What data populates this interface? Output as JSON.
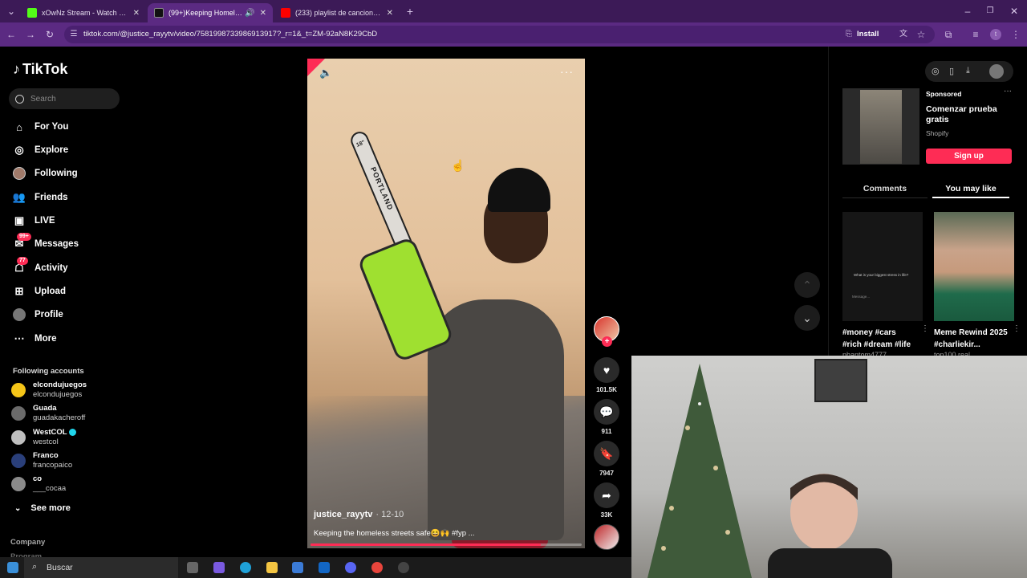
{
  "browser": {
    "tabs": [
      {
        "title": "xOwNz Stream - Watch Live on",
        "favicon_color": "#53fc18"
      },
      {
        "title": "(99+)Keeping Homeless In",
        "favicon_color": "#000000"
      },
      {
        "title": "(233) playlist de canciones sad",
        "favicon_color": "#ff0000"
      }
    ],
    "url": "tiktok.com/@justice_rayytv/video/7581998733986913917?_r=1&_t=ZM-92aN8K29CbD",
    "install_label": "Install"
  },
  "sidebar": {
    "logo": "TikTok",
    "search_placeholder": "Search",
    "nav": [
      {
        "label": "For You",
        "icon": "home-icon"
      },
      {
        "label": "Explore",
        "icon": "compass-icon"
      },
      {
        "label": "Following",
        "icon": "avatar-icon"
      },
      {
        "label": "Friends",
        "icon": "friends-icon"
      },
      {
        "label": "LIVE",
        "icon": "live-icon"
      },
      {
        "label": "Messages",
        "icon": "messages-icon",
        "badge": "99+"
      },
      {
        "label": "Activity",
        "icon": "activity-icon",
        "badge": "77"
      },
      {
        "label": "Upload",
        "icon": "upload-icon"
      },
      {
        "label": "Profile",
        "icon": "profile-icon"
      },
      {
        "label": "More",
        "icon": "more-icon"
      }
    ],
    "following_title": "Following accounts",
    "accounts": [
      {
        "name": "elcondujuegos",
        "handle": "elcondujuegos",
        "color": "#f5c518"
      },
      {
        "name": "Guada",
        "handle": "guadakacheroff",
        "color": "#6b6b6b"
      },
      {
        "name": "WestCOL",
        "handle": "westcol",
        "color": "#bfbfbf",
        "verified": true
      },
      {
        "name": "Franco",
        "handle": "francopaico",
        "color": "#2a3f7a"
      },
      {
        "name": "co",
        "handle": "___cocaa",
        "color": "#8a8a8a"
      }
    ],
    "see_more": "See more",
    "company": "Company",
    "program": "Program"
  },
  "video": {
    "author": "justice_rayytv",
    "date": "· 12-10",
    "caption": "Keeping the homeless streets safe😆🙌 #fyp ...",
    "progress": 0.85,
    "saw_label": "PORTLAND",
    "saw_label_small": "18\""
  },
  "actions": {
    "likes": "101.5K",
    "comments": "911",
    "saves": "7947",
    "shares": "33K"
  },
  "right_panel": {
    "sponsored_label": "Sponsored",
    "ad_title": "Comenzar prueba gratis",
    "ad_brand": "Shopify",
    "signup_label": "Sign up",
    "tab_comments": "Comments",
    "tab_you_may_like": "You may like",
    "recommendations": [
      {
        "caption": "#money #cars #rich #dream #life",
        "user": "phantom4777"
      },
      {
        "caption": "Meme Rewind 2025 #charliekir...",
        "user": "top100.real"
      }
    ],
    "chat_thumb": {
      "question": "What is your biggest stress in life?",
      "placeholder": "Message..."
    }
  },
  "taskbar": {
    "search_label": "Buscar"
  },
  "colors": {
    "brand": "#fe2c55",
    "browser_purple": "#5b2a82"
  }
}
